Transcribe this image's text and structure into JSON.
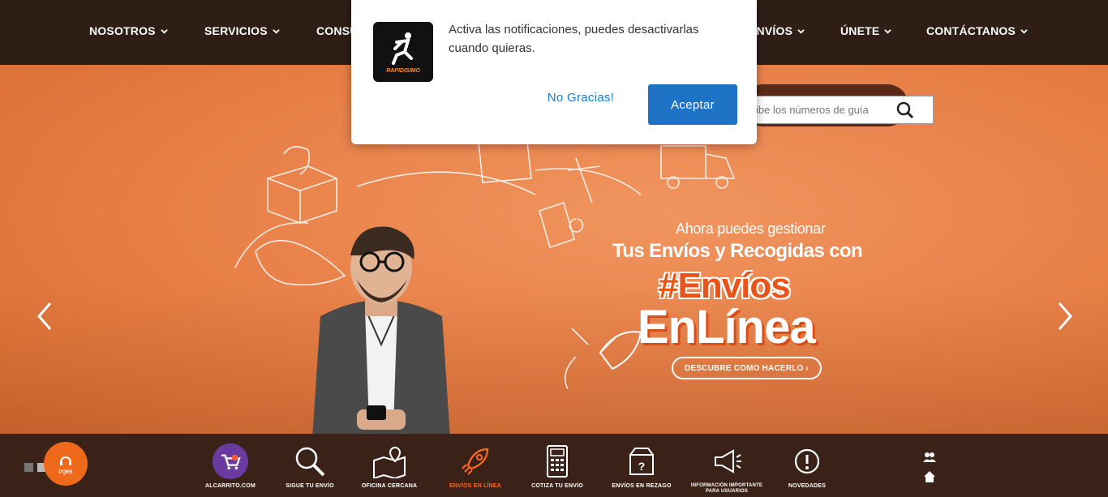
{
  "nav": {
    "items": [
      {
        "label": "NOSOTROS"
      },
      {
        "label": "SERVICIOS"
      },
      {
        "label": "CONSU"
      },
      {
        "label": "ENVÍOS"
      },
      {
        "label": "ÚNETE"
      },
      {
        "label": "CONTÁCTANOS"
      }
    ]
  },
  "tracking": {
    "placeholder": "ibe los números de guía",
    "icon": "search-icon"
  },
  "hero": {
    "subtitle": "Ahora puedes gestionar",
    "title": "Tus Envíos y Recogidas con",
    "hashtag": "#Envíos",
    "brandline": "EnLínea",
    "cta": "DESCUBRE COMO HACERLO ›",
    "prev_icon": "chevron-left-icon",
    "next_icon": "chevron-right-icon",
    "slide_dots": 2,
    "active_slide": 2
  },
  "bottombar": {
    "pqrs": "PQRS",
    "items": [
      {
        "label": "ALCARRITO.COM",
        "icon": "cart-icon"
      },
      {
        "label": "SIGUE TU ENVÍO",
        "icon": "magnifier-icon"
      },
      {
        "label": "OFICINA CERCANA",
        "icon": "map-pin-icon"
      },
      {
        "label": "ENVÍOS EN LÍNEA",
        "icon": "rocket-icon",
        "active": true
      },
      {
        "label": "COTIZA TU ENVÍO",
        "icon": "calculator-icon"
      },
      {
        "label": "ENVÍOS EN REZAGO",
        "icon": "box-question-icon"
      },
      {
        "label": "INFORMACIÓN IMPORTANTE PARA USUARIOS",
        "icon": "megaphone-icon"
      },
      {
        "label": "NOVEDADES",
        "icon": "alert-icon"
      }
    ]
  },
  "modal": {
    "logo_text": "RAPIDISIMO",
    "message": "Activa las notificaciones, puedes desactivarlas cuando quieras.",
    "decline": "No Gracias!",
    "accept": "Aceptar"
  },
  "colors": {
    "nav_bg": "#2e1e16",
    "hero_orange": "#e9824a",
    "accent": "#e8541a",
    "button_blue": "#1f73c7"
  }
}
